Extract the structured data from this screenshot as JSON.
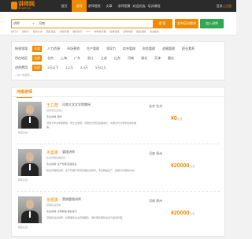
{
  "header": {
    "logo_text": "讲师网",
    "logo_sub": "Jiangshi.org",
    "nav": [
      "首页",
      "讲师",
      "讲师视频",
      "文章",
      "讲师招募",
      "欢迎光临",
      "培训课程"
    ],
    "nav_active_index": 1,
    "login": "登录",
    "register": "注册"
  },
  "search": {
    "category": "讲师",
    "query": "河南",
    "button": "搜 索",
    "post_button": "发布培训需求",
    "join_button": "加入讲师",
    "hotwords": [
      "执行力",
      "领导力",
      "阳光心态",
      "团队建设",
      "中层管理",
      "销售技巧",
      "TTT",
      "非财务管理",
      "绩效管理",
      "采购管理",
      "股权激励",
      "商业模式"
    ]
  },
  "filter": {
    "rows": [
      {
        "label": "授课领域",
        "options": [
          "全部",
          "人力资源",
          "市场营销",
          "生产管理",
          "领导力",
          "综合管理",
          "财务管理",
          "战略管理",
          "职业素养"
        ],
        "active": 0
      },
      {
        "label": "所在地区",
        "options": [
          "全部",
          "北京",
          "上海",
          "广东",
          "浙江",
          "江苏",
          "山东",
          "河南",
          "湖北",
          "天津",
          "重庆"
        ],
        "active": 0
      },
      {
        "label": "讲师费用",
        "options": [
          "全部",
          "1万以下",
          "1-2万",
          "2-3万",
          "3万以上"
        ],
        "active": 0
      }
    ],
    "more": "—共 1 位讲师—"
  },
  "list": {
    "title": "河南讲师",
    "cards": [
      {
        "name": "王立群",
        "tag": "河南大学文学院教授",
        "verify": "实名认证",
        "sub": "百家讲坛主讲人",
        "field": "专业领域: 国学",
        "desc": "河南大学文学院教授，博士生导师。中国史记研究会副会长，中国汉代文学学会常务理事。",
        "location": "北京 北京",
        "price": "¥0",
        "price_unit": "元/天"
      },
      {
        "name": "冬曼惠",
        "tag": "管理讲师",
        "verify": "实名认证",
        "sub": "企业管理咨询顾问",
        "field": "专业领域: 生产管理 班组建设",
        "desc": "职业管理培训师，生产管理与现场管理资深顾问，专注精益生产、班组长管理等方向。",
        "location": "河南 郑州",
        "price": "¥20000",
        "price_unit": "元/天"
      },
      {
        "name": "张顺勇",
        "tag": "营销管理讲师",
        "verify": "实名认证",
        "sub": "营销实战专家",
        "field": "专业领域: 市场营销 销售技巧",
        "desc": "营销实战派讲师，长期服务企业营销团队，擅长销售团队建设与渠道管理。",
        "location": "河南 郑州",
        "price": "¥20000",
        "price_unit": "元/天"
      }
    ]
  }
}
